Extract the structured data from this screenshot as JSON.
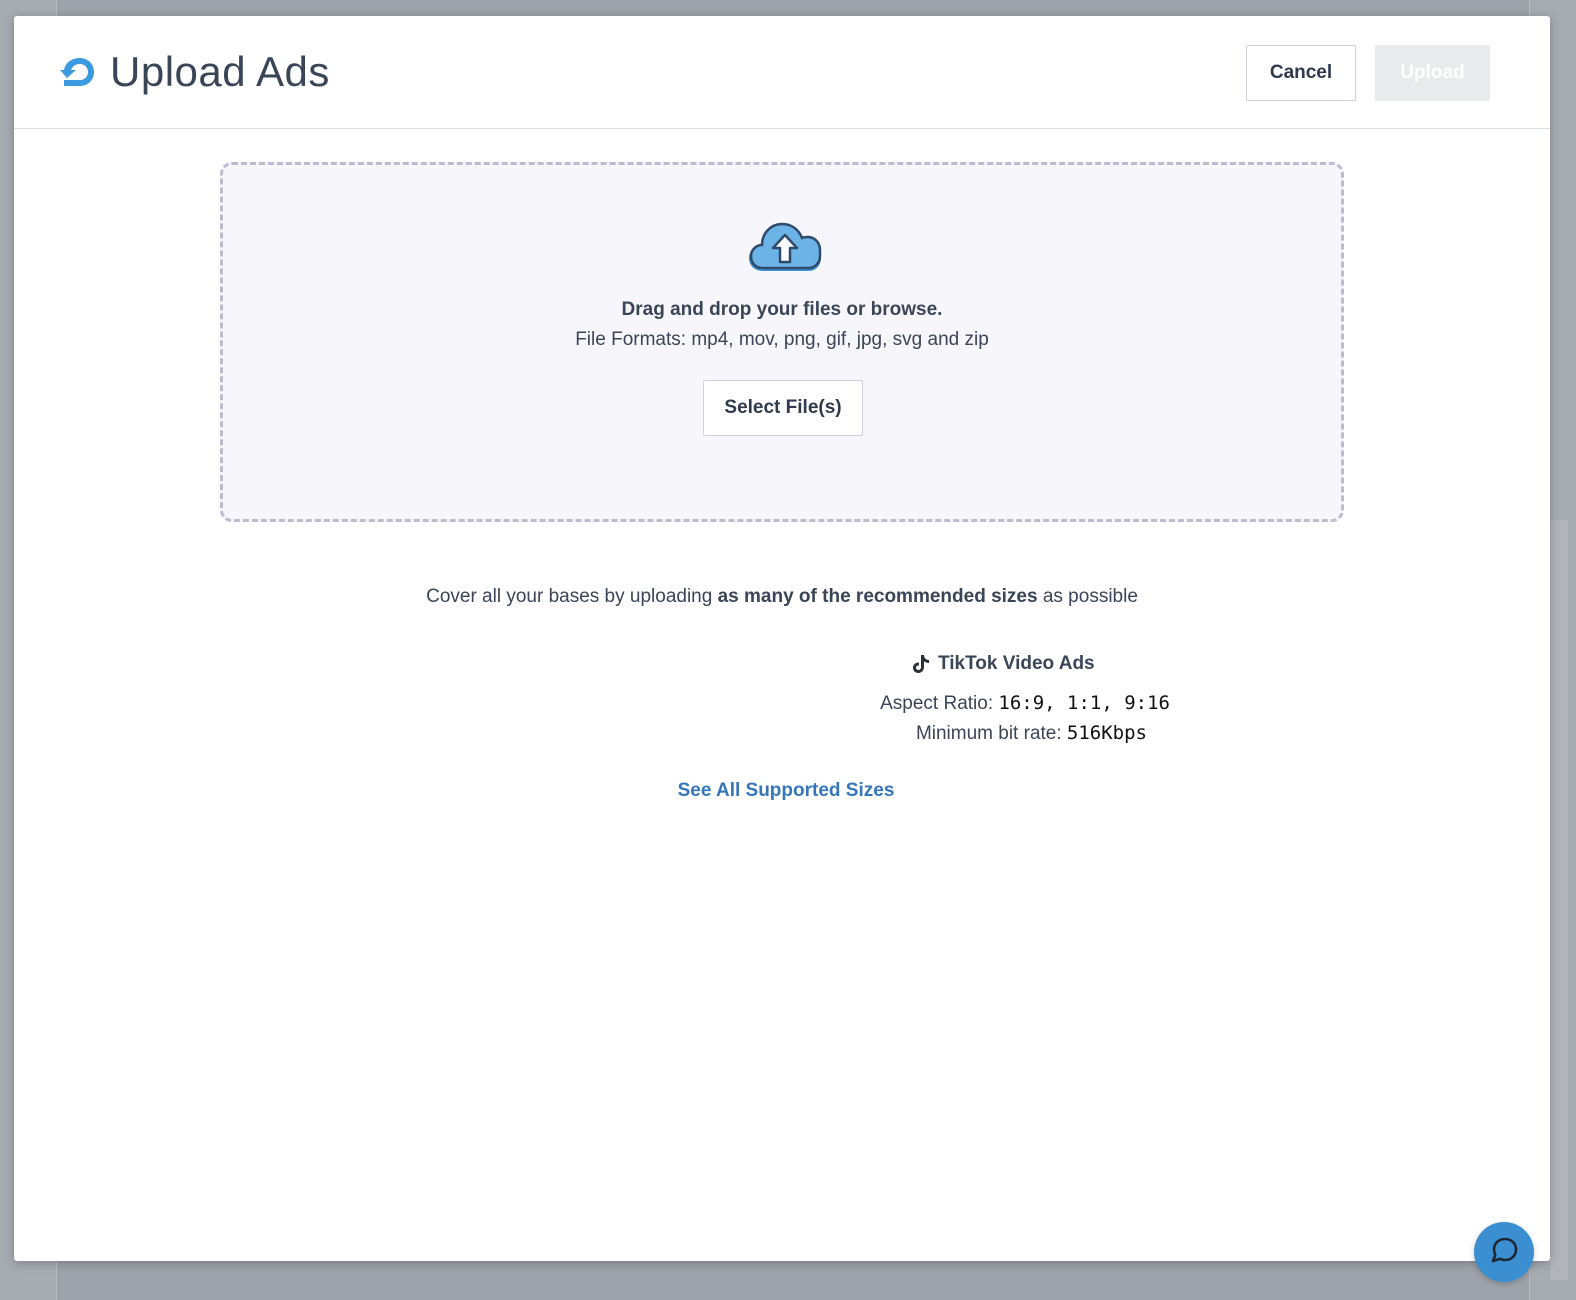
{
  "modal": {
    "title": "Upload Ads",
    "logo_icon": "brand-logo-icon",
    "cancel_label": "Cancel",
    "upload_label": "Upload",
    "upload_disabled": true
  },
  "dropzone": {
    "icon": "cloud-upload-icon",
    "title": "Drag and drop your files or browse.",
    "formats": "File Formats: mp4, mov, png, gif, jpg, svg and zip",
    "select_label": "Select File(s)"
  },
  "recommendation": {
    "prefix": "Cover all your bases by uploading ",
    "emphasis": "as many of the recommended sizes",
    "suffix": " as possible"
  },
  "tiktok": {
    "icon": "tiktok-icon",
    "heading": "TikTok Video Ads",
    "aspect_label": "Aspect Ratio: ",
    "aspect_value": "16:9, 1:1, 9:16",
    "bitrate_label": "Minimum bit rate: ",
    "bitrate_value": "516Kbps"
  },
  "see_all_label": "See All Supported Sizes",
  "chat": {
    "icon": "chat-bubble-icon"
  },
  "colors": {
    "accent": "#3b8fd0",
    "link": "#3577b8",
    "text": "#3a4558",
    "dropzone_bg": "#f7f7fb",
    "dropzone_border": "#bdbbd0",
    "disabled_button": "#e9eaec"
  }
}
